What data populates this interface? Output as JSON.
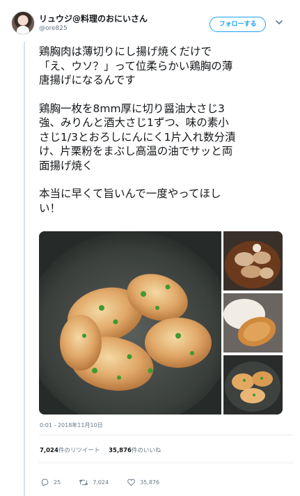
{
  "user": {
    "display_name": "リュウジ@料理のおにいさん",
    "handle": "@ore825",
    "follow_label": "フォローする"
  },
  "tweet": {
    "paragraphs": [
      [
        "鶏胸肉は薄切りにし揚げ焼くだけで",
        "「え、ウソ？」って位柔らかい鶏胸の薄",
        "唐揚げになるんです"
      ],
      [
        "鶏胸一枚を8mm厚に切り醤油大さじ3",
        "強、みりんと酒大さじ1ずつ、味の素小",
        "さじ1/3とおろしにんにく1片入れ数分漬",
        "け、片栗粉をまぶし高温の油でサッと両",
        "面揚げ焼く"
      ],
      [
        "本当に早くて旨いんで一度やってほし",
        "い！"
      ]
    ],
    "timestamp": "0:01 - 2018年11月10日"
  },
  "stats": {
    "retweets_count": "7,024",
    "retweets_label": "件のリツイート",
    "likes_count": "35,876",
    "likes_label": "件のいいね"
  },
  "actions": {
    "reply_count": "25",
    "retweet_count": "7,024",
    "like_count": "35,876"
  },
  "colors": {
    "accent": "#1da1f2",
    "muted": "#657786",
    "divider": "#e6ecf0"
  },
  "icons": [
    "chevron-down-icon",
    "reply-icon",
    "retweet-icon",
    "heart-icon"
  ]
}
